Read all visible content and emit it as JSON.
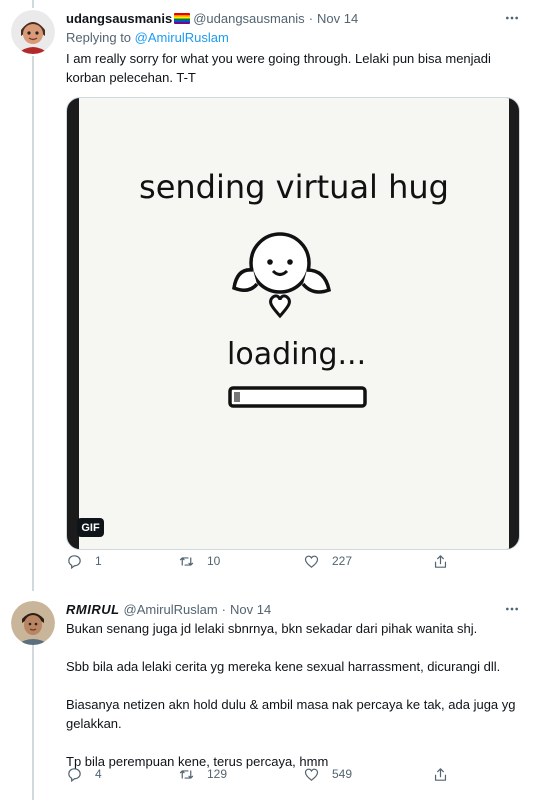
{
  "tweet1": {
    "display_name": "udangsausmanis",
    "handle": "@udangsausmanis",
    "separator": "·",
    "date": "Nov 14",
    "replying_prefix": "Replying to",
    "replying_to": "@AmirulRuslam",
    "text": "I am really sorry for what you were going through. Lelaki pun bisa menjadi korban pelecehan. T-T",
    "gif": {
      "caption": "sending virtual hug",
      "loading_text": "loading...",
      "badge": "GIF",
      "progress": 0.05
    },
    "actions": {
      "reply_count": "1",
      "retweet_count": "10",
      "like_count": "227"
    }
  },
  "tweet2": {
    "display_name": "RMIRUL",
    "handle": "@AmirulRuslam",
    "separator": "·",
    "date": "Nov 14",
    "paragraphs": [
      "Bukan senang juga jd lelaki sbnrnya, bkn sekadar dari pihak wanita shj.",
      "Sbb bila ada lelaki cerita yg mereka kene sexual harrassment, dicurangi dll.",
      "Biasanya netizen akn hold dulu & ambil masa nak percaya ke tak, ada juga yg gelakkan.",
      "Tp bila perempuan kene, terus percaya, hmm"
    ],
    "actions": {
      "reply_count": "4",
      "retweet_count": "129",
      "like_count": "549"
    }
  },
  "colors": {
    "text_primary": "#0f1419",
    "text_secondary": "#536471",
    "link": "#1d9bf0",
    "divider": "#cfd9de"
  }
}
